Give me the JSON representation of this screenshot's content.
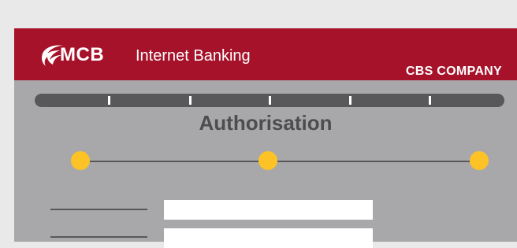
{
  "colors": {
    "page_background": "#e9e9ea",
    "header_background": "#a6122a",
    "panel_background": "#a8a8aa",
    "progress_bar": "#58585a",
    "step_dot": "#fdc326",
    "title_text": "#4d4d4f"
  },
  "header": {
    "logo_icon": "mcb-emblem-icon",
    "logo_text": "MCB",
    "product_name": "Internet Banking",
    "company_name": "CBS COMPANY"
  },
  "main": {
    "title": "Authorisation",
    "progress_segments": 6,
    "steps": 3,
    "fields": [
      {
        "label": "",
        "value": ""
      },
      {
        "label": "",
        "value": ""
      }
    ]
  }
}
